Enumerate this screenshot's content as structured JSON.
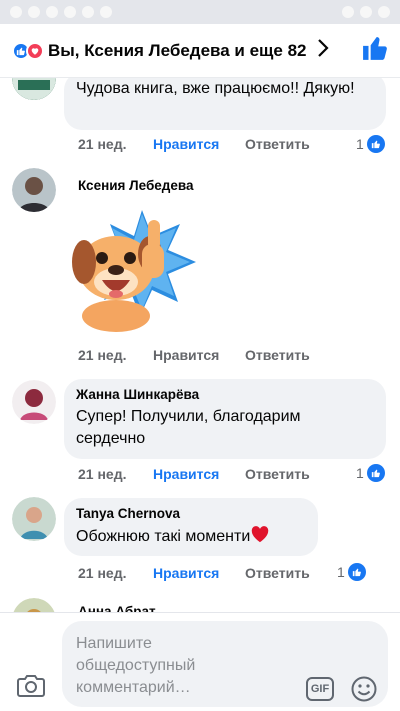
{
  "header": {
    "title": "Вы, Ксения Лебедева и еще 82"
  },
  "comments": [
    {
      "text": "Чудова книга, вже працюємо!! Дякую!",
      "time": "21 нед.",
      "like_label": "Нравится",
      "reply_label": "Ответить",
      "like_count": "1",
      "liked_by_me": true
    },
    {
      "author": "Ксения Лебедева",
      "sticker": "puppy-thumbs-up",
      "time": "21 нед.",
      "like_label": "Нравится",
      "reply_label": "Ответить",
      "liked_by_me": false
    },
    {
      "author": "Жанна Шинкарёва",
      "text": "Супер! Получили, благодарим сердечно",
      "time": "21 нед.",
      "like_label": "Нравится",
      "reply_label": "Ответить",
      "like_count": "1",
      "liked_by_me": true
    },
    {
      "author": "Tanya Chernova",
      "text": "Обожнюю такі моменти",
      "time": "21 нед.",
      "like_label": "Нравится",
      "reply_label": "Ответить",
      "like_count": "1",
      "liked_by_me": true
    },
    {
      "author": "Анна Абрат"
    }
  ],
  "composer": {
    "placeholder": "Напишите общедоступный комментарий…",
    "gif_label": "GIF"
  },
  "colors": {
    "accent": "#1877f2",
    "love": "#f33e58",
    "bubble": "#f0f2f5",
    "muted": "#65676b"
  },
  "icons": {
    "header": [
      "like-reaction-icon",
      "love-reaction-icon",
      "chevron-right-icon",
      "thumbs-up-icon"
    ],
    "composer": [
      "camera-icon",
      "gif-icon",
      "emoji-icon"
    ]
  }
}
